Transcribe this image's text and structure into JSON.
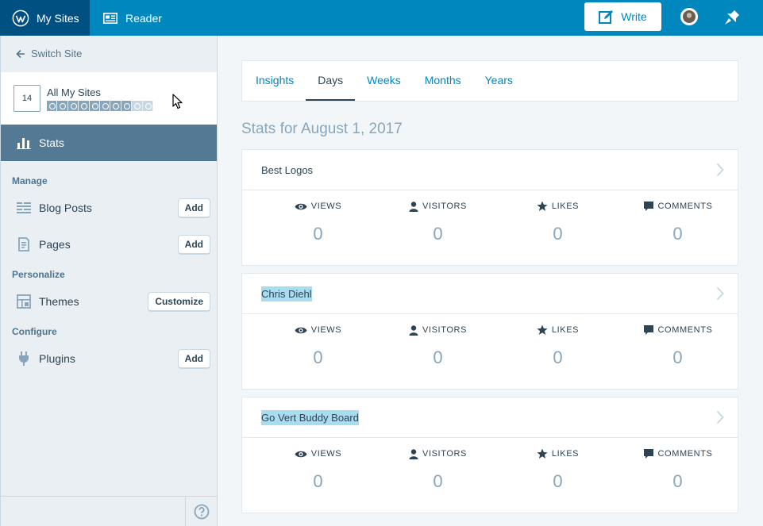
{
  "masterbar": {
    "my_sites": "My Sites",
    "reader": "Reader",
    "write": "Write"
  },
  "sidebar": {
    "switch_site": "Switch Site",
    "site_count": "14",
    "site_name": "All My Sites",
    "stats_label": "Stats",
    "sections": {
      "manage": "Manage",
      "personalize": "Personalize",
      "configure": "Configure"
    },
    "items": [
      {
        "label": "Blog Posts",
        "button": "Add",
        "icon": "posts-icon"
      },
      {
        "label": "Pages",
        "button": "Add",
        "icon": "pages-icon"
      },
      {
        "label": "Themes",
        "button": "Customize",
        "icon": "themes-icon"
      },
      {
        "label": "Plugins",
        "button": "Add",
        "icon": "plugins-icon"
      }
    ]
  },
  "main": {
    "tabs": [
      {
        "label": "Insights"
      },
      {
        "label": "Days",
        "active": true
      },
      {
        "label": "Weeks"
      },
      {
        "label": "Months"
      },
      {
        "label": "Years"
      }
    ],
    "title": "Stats for August 1, 2017",
    "stat_labels": {
      "views": "VIEWS",
      "visitors": "VISITORS",
      "likes": "LIKES",
      "comments": "COMMENTS"
    },
    "sites": [
      {
        "name": "Best Logos",
        "views": "0",
        "visitors": "0",
        "likes": "0",
        "comments": "0"
      },
      {
        "name": "Chris Diehl",
        "views": "0",
        "visitors": "0",
        "likes": "0",
        "comments": "0"
      },
      {
        "name": "Go Vert Buddy Board",
        "views": "0",
        "visitors": "0",
        "likes": "0",
        "comments": "0"
      }
    ]
  },
  "colors": {
    "masterbar": "#0087be",
    "masterbar_active": "#005082",
    "sidebar_selected": "#537994",
    "link": "#0087be",
    "muted": "#87a6bc",
    "highlight": "#a8dcf1"
  }
}
